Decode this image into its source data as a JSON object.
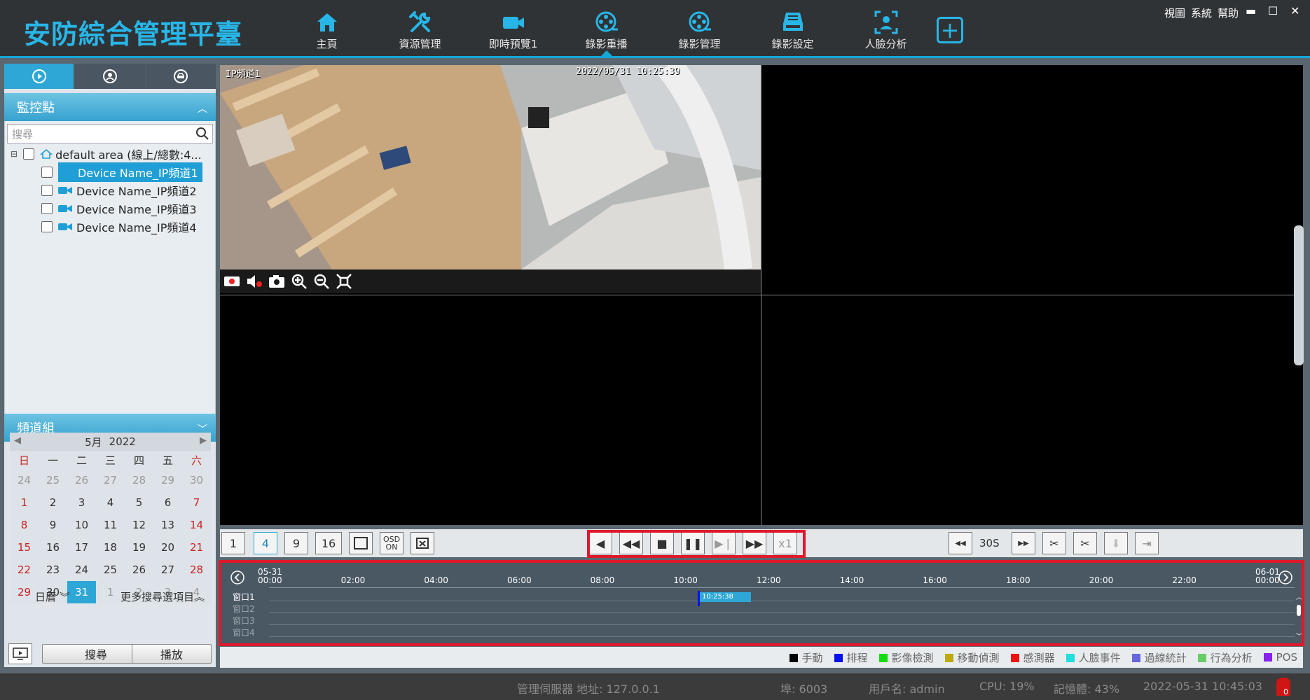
{
  "app": {
    "title": "安防綜合管理平臺"
  },
  "nav": [
    {
      "label": "主頁",
      "icon": "home-icon"
    },
    {
      "label": "資源管理",
      "icon": "tools-icon"
    },
    {
      "label": "即時預覽1",
      "icon": "video-camera-icon"
    },
    {
      "label": "錄影重播",
      "icon": "film-reel-icon",
      "active": true
    },
    {
      "label": "錄影管理",
      "icon": "film-reel-icon"
    },
    {
      "label": "錄影設定",
      "icon": "hdd-icon"
    },
    {
      "label": "人臉分析",
      "icon": "face-scan-icon"
    }
  ],
  "system_menu": {
    "view": "視圖",
    "system": "系統",
    "help": "幫助"
  },
  "left": {
    "monitor_title": "監控點",
    "search_placeholder": "搜尋",
    "area": "default area (線上/總數:4...",
    "devices": [
      "Device Name_IP頻道1",
      "Device Name_IP頻道2",
      "Device Name_IP頻道3",
      "Device Name_IP頻道4"
    ],
    "group_title": "頻道組"
  },
  "calendar": {
    "month": "5月",
    "year": "2022",
    "weekdays": [
      "日",
      "一",
      "二",
      "三",
      "四",
      "五",
      "六"
    ],
    "days": [
      "24",
      "25",
      "26",
      "27",
      "28",
      "29",
      "30",
      "1",
      "2",
      "3",
      "4",
      "5",
      "6",
      "7",
      "8",
      "9",
      "10",
      "11",
      "12",
      "13",
      "14",
      "15",
      "16",
      "17",
      "18",
      "19",
      "20",
      "21",
      "22",
      "23",
      "24",
      "25",
      "26",
      "27",
      "28",
      "29",
      "30",
      "31",
      "1",
      "2",
      "3",
      "4"
    ],
    "today": "31",
    "mode_label": "日曆",
    "more_label": "更多搜尋選項目",
    "search_btn": "搜尋",
    "play_btn": "播放"
  },
  "video": {
    "channel_osd": "IP頻道1",
    "time_osd": "2022/05/31 10:25:39"
  },
  "controls": {
    "layout_buttons": [
      "1",
      "4",
      "9",
      "16"
    ],
    "osd_label": "OSD ON",
    "speed": "x1",
    "skip": "30S"
  },
  "timeline": {
    "start_date": "05-31",
    "end_date": "06-01",
    "hours": [
      "00:00",
      "02:00",
      "04:00",
      "06:00",
      "08:00",
      "10:00",
      "12:00",
      "14:00",
      "16:00",
      "18:00",
      "20:00",
      "22:00",
      "00:00"
    ],
    "windows": [
      "窗口1",
      "窗口2",
      "窗口3",
      "窗口4"
    ],
    "cursor_time": "10:25:38"
  },
  "legend": [
    {
      "label": "手動",
      "color": "#000000"
    },
    {
      "label": "排程",
      "color": "#0011ee"
    },
    {
      "label": "影像檢測",
      "color": "#11dd11"
    },
    {
      "label": "移動偵測",
      "color": "#bbaa11"
    },
    {
      "label": "感測器",
      "color": "#ee1111"
    },
    {
      "label": "人臉事件",
      "color": "#22dddd"
    },
    {
      "label": "過線統計",
      "color": "#6666dd"
    },
    {
      "label": "行為分析",
      "color": "#66cc66"
    },
    {
      "label": "POS",
      "color": "#8822ee"
    }
  ],
  "status": {
    "server": "管理伺服器 地址: 127.0.0.1",
    "port": "埠: 6003",
    "user": "用戶名: admin",
    "cpu": "CPU: 19%",
    "memory": "記憶體: 43%",
    "datetime": "2022-05-31 10:45:03",
    "alarm_count": "0"
  }
}
